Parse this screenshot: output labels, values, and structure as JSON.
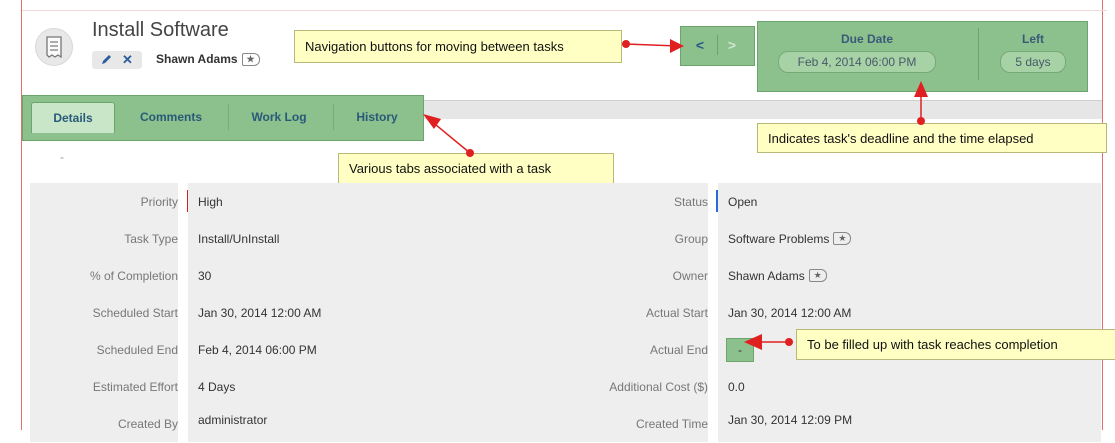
{
  "header": {
    "title": "Install Software",
    "owner": "Shawn Adams",
    "edit_icon": "pencil-icon",
    "delete_icon": "close-icon"
  },
  "nav": {
    "prev": "<",
    "next": ">"
  },
  "deadline": {
    "due_label": "Due Date",
    "due_value": "Feb 4, 2014 06:00 PM",
    "left_label": "Left",
    "left_value": "5 days"
  },
  "tabs": [
    {
      "label": "Details",
      "active": true
    },
    {
      "label": "Comments"
    },
    {
      "label": "Work Log"
    },
    {
      "label": "History"
    }
  ],
  "description_placeholder": "-",
  "callouts": {
    "navigation": "Navigation buttons for moving between tasks",
    "deadline": "Indicates task's deadline and the time elapsed",
    "tabs": "Various tabs associated with a task",
    "actual_end": "To be filled up with task reaches completion"
  },
  "fields": {
    "left": [
      {
        "label": "Priority",
        "value": "High"
      },
      {
        "label": "Task Type",
        "value": "Install/UnInstall"
      },
      {
        "label": "% of Completion",
        "value": "30"
      },
      {
        "label": "Scheduled Start",
        "value": "Jan 30, 2014 12:00 AM"
      },
      {
        "label": "Scheduled End",
        "value": "Feb 4, 2014 06:00 PM"
      },
      {
        "label": "Estimated Effort",
        "value": "4 Days"
      },
      {
        "label": "Created By",
        "value": "administrator"
      }
    ],
    "right": [
      {
        "label": "Status",
        "value": "Open"
      },
      {
        "label": "Group",
        "value": "Software Problems"
      },
      {
        "label": "Owner",
        "value": "Shawn Adams"
      },
      {
        "label": "Actual Start",
        "value": "Jan 30, 2014 12:00 AM"
      },
      {
        "label": "Actual End",
        "value": "-"
      },
      {
        "label": "Additional Cost ($)",
        "value": "0.0"
      },
      {
        "label": "Created Time",
        "value": "Jan 30, 2014 12:09 PM"
      }
    ]
  },
  "colors": {
    "highlight_green": "#8cc08c",
    "callout_yellow": "#ffffc4",
    "arrow_red": "#e02020",
    "priority_high": "#d42020",
    "status_open": "#2a6ad8"
  }
}
